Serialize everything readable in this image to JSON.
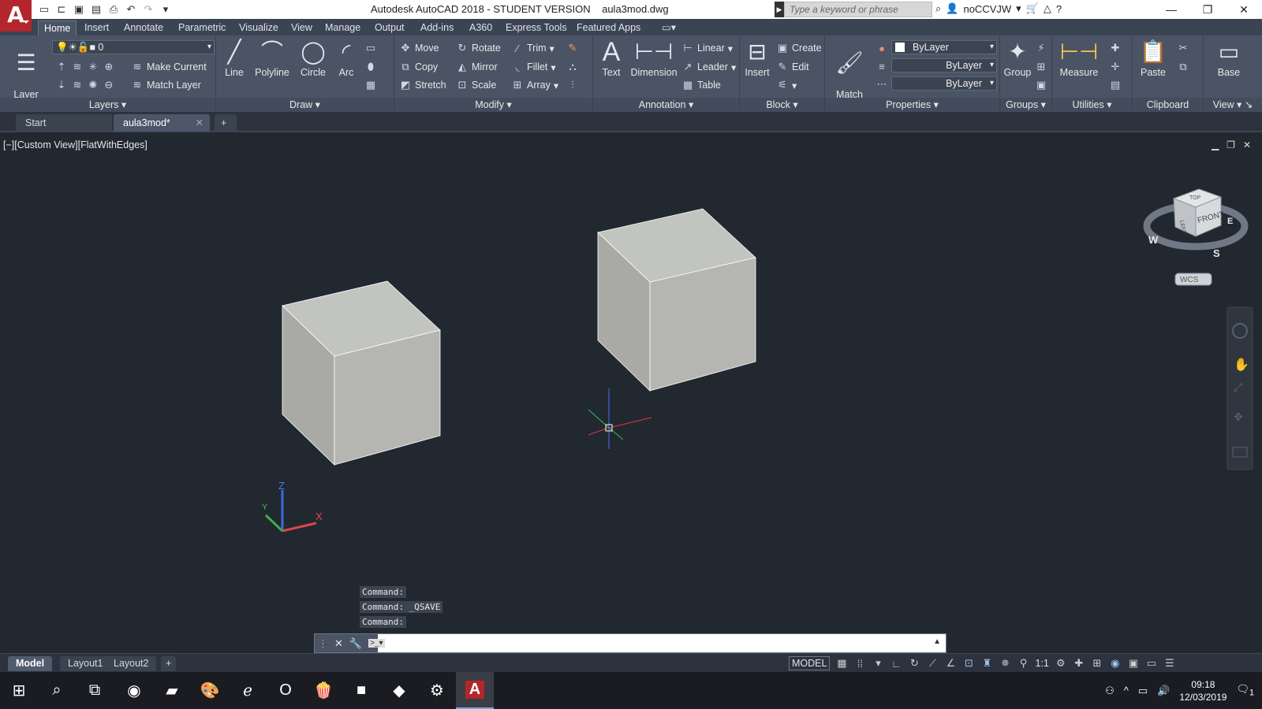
{
  "title_bar": {
    "app_logo": "A",
    "title": "Autodesk AutoCAD 2018 - STUDENT VERSION    aula3mod.dwg",
    "search_placeholder": "Type a keyword or phrase",
    "user": "noCCVJW"
  },
  "ribbon_tabs": [
    "Home",
    "Insert",
    "Annotate",
    "Parametric",
    "Visualize",
    "View",
    "Manage",
    "Output",
    "Add-ins",
    "A360",
    "Express Tools",
    "Featured Apps"
  ],
  "ribbon": {
    "layers": {
      "title": "Layers",
      "layer_properties": "Layer\nProperties",
      "current_layer": "0",
      "make_current": "Make Current",
      "match_layer": "Match Layer"
    },
    "draw": {
      "title": "Draw",
      "line": "Line",
      "polyline": "Polyline",
      "circle": "Circle",
      "arc": "Arc"
    },
    "modify": {
      "title": "Modify",
      "move": "Move",
      "rotate": "Rotate",
      "trim": "Trim",
      "copy": "Copy",
      "mirror": "Mirror",
      "fillet": "Fillet",
      "stretch": "Stretch",
      "scale": "Scale",
      "array": "Array"
    },
    "annotation": {
      "title": "Annotation",
      "text": "Text",
      "dimension": "Dimension",
      "linear": "Linear",
      "leader": "Leader",
      "table": "Table"
    },
    "block": {
      "title": "Block",
      "insert": "Insert",
      "create": "Create",
      "edit": "Edit"
    },
    "properties": {
      "title": "Properties",
      "match_properties": "Match\nProperties",
      "color": "ByLayer",
      "linetype": "ByLayer",
      "lineweight": "ByLayer"
    },
    "groups": {
      "title": "Groups",
      "group": "Group"
    },
    "utilities": {
      "title": "Utilities",
      "measure": "Measure"
    },
    "clipboard": {
      "title": "Clipboard",
      "paste": "Paste"
    },
    "view": {
      "title": "View",
      "base": "Base"
    }
  },
  "doc_tabs": [
    "Start",
    "aula3mod*"
  ],
  "viewport": {
    "label": "[−][Custom View][FlatWithEdges]",
    "viewcube": {
      "top": "TOP",
      "left": "LEFT",
      "front": "FRONT",
      "compass_w": "W",
      "compass_s": "S",
      "compass_e": "E",
      "wcs": "WCS"
    },
    "ucs": {
      "x": "X",
      "y": "Y",
      "z": "Z"
    }
  },
  "command": {
    "history": [
      "Command:",
      "Command: _QSAVE",
      "Command:"
    ],
    "input_value": ""
  },
  "layout_tabs": [
    "Model",
    "Layout1",
    "Layout2"
  ],
  "status": {
    "model": "MODEL",
    "scale": "1:1"
  },
  "taskbar": {
    "time": "09:18",
    "date": "12/03/2019",
    "notifications": "1"
  },
  "colors": {
    "viewport_bg": "#212830",
    "ribbon_bg": "#4a5465",
    "cube_face": "#b7b9b5",
    "accent": "#b3262b"
  }
}
